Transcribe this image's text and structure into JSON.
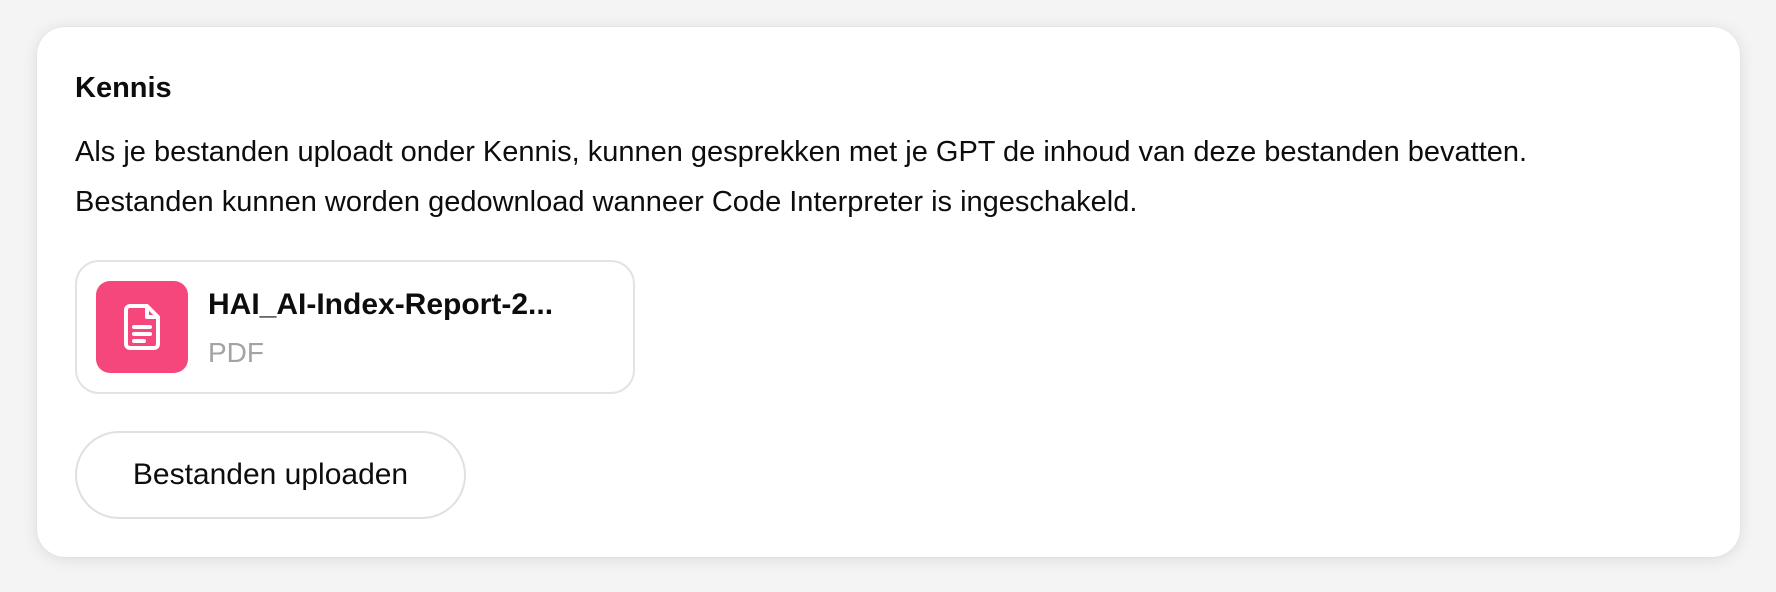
{
  "knowledge": {
    "title": "Kennis",
    "description": "Als je bestanden uploadt onder Kennis, kunnen gesprekken met je GPT de inhoud van deze bestanden bevatten. Bestanden kunnen worden gedownload wanneer Code Interpreter is ingeschakeld.",
    "files": [
      {
        "name": "HAI_AI-Index-Report-2...",
        "type": "PDF",
        "icon": "document-icon",
        "icon_color": "#f6477c"
      }
    ],
    "upload_button_label": "Bestanden uploaden"
  }
}
